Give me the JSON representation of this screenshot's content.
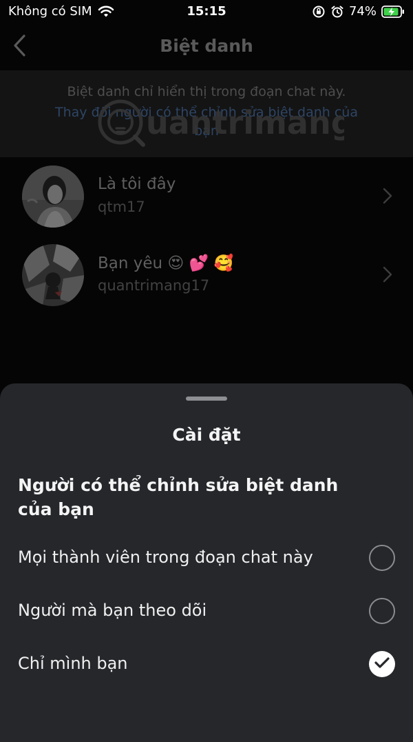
{
  "status_bar": {
    "carrier": "Không có SIM",
    "time": "15:15",
    "battery": "74%"
  },
  "nav": {
    "title": "Biệt danh"
  },
  "description": {
    "text": "Biệt danh chỉ hiển thị trong đoạn chat này.",
    "link": "Thay đổi người có thể chỉnh sửa biệt danh của bạn"
  },
  "watermark": {
    "text": "uantrimang"
  },
  "members": [
    {
      "name": "Là tôi đây",
      "username": "qtm17"
    },
    {
      "name": "Bạn yêu 😍 💕 🥰",
      "username": "quantrimang17"
    }
  ],
  "sheet": {
    "title": "Cài đặt",
    "heading": "Người có thể chỉnh sửa biệt danh của bạn",
    "options": [
      {
        "label": "Mọi thành viên trong đoạn chat này",
        "selected": false
      },
      {
        "label": "Người mà bạn theo dõi",
        "selected": false
      },
      {
        "label": "Chỉ mình bạn",
        "selected": true
      }
    ]
  },
  "colors": {
    "sheet_bg": "#25272b",
    "accent_link": "#2e4565"
  }
}
